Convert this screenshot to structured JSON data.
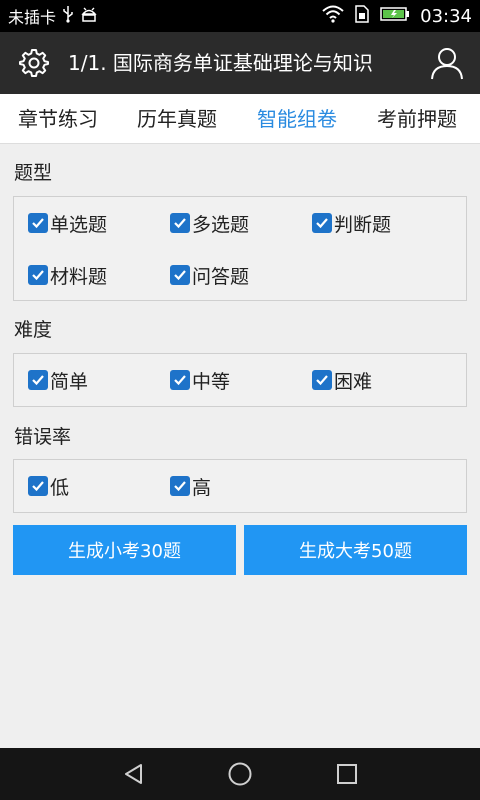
{
  "status_bar": {
    "carrier": "未插卡",
    "time": "03:34",
    "icons": [
      "usb-icon",
      "android-debug-icon",
      "wifi-icon",
      "sim-icon",
      "battery-charging-icon"
    ]
  },
  "app_bar": {
    "title": "1/1. 国际商务单证基础理论与知识",
    "left_icon": "gear-icon",
    "right_icon": "user-icon"
  },
  "tabs": [
    {
      "label": "章节练习",
      "active": false
    },
    {
      "label": "历年真题",
      "active": false
    },
    {
      "label": "智能组卷",
      "active": true
    },
    {
      "label": "考前押题",
      "active": false
    }
  ],
  "sections": {
    "question_type": {
      "label": "题型",
      "options": [
        {
          "label": "单选题",
          "checked": true
        },
        {
          "label": "多选题",
          "checked": true
        },
        {
          "label": "判断题",
          "checked": true
        },
        {
          "label": "材料题",
          "checked": true
        },
        {
          "label": "问答题",
          "checked": true
        }
      ]
    },
    "difficulty": {
      "label": "难度",
      "options": [
        {
          "label": "简单",
          "checked": true
        },
        {
          "label": "中等",
          "checked": true
        },
        {
          "label": "困难",
          "checked": true
        }
      ]
    },
    "error_rate": {
      "label": "错误率",
      "options": [
        {
          "label": "低",
          "checked": true
        },
        {
          "label": "高",
          "checked": true
        }
      ]
    }
  },
  "buttons": {
    "small_exam": "生成小考30题",
    "big_exam": "生成大考50题"
  },
  "colors": {
    "accent": "#2196f3",
    "active_tab": "#2a8be0",
    "checkbox": "#1e73c9",
    "app_bar": "#2b2b2b"
  }
}
